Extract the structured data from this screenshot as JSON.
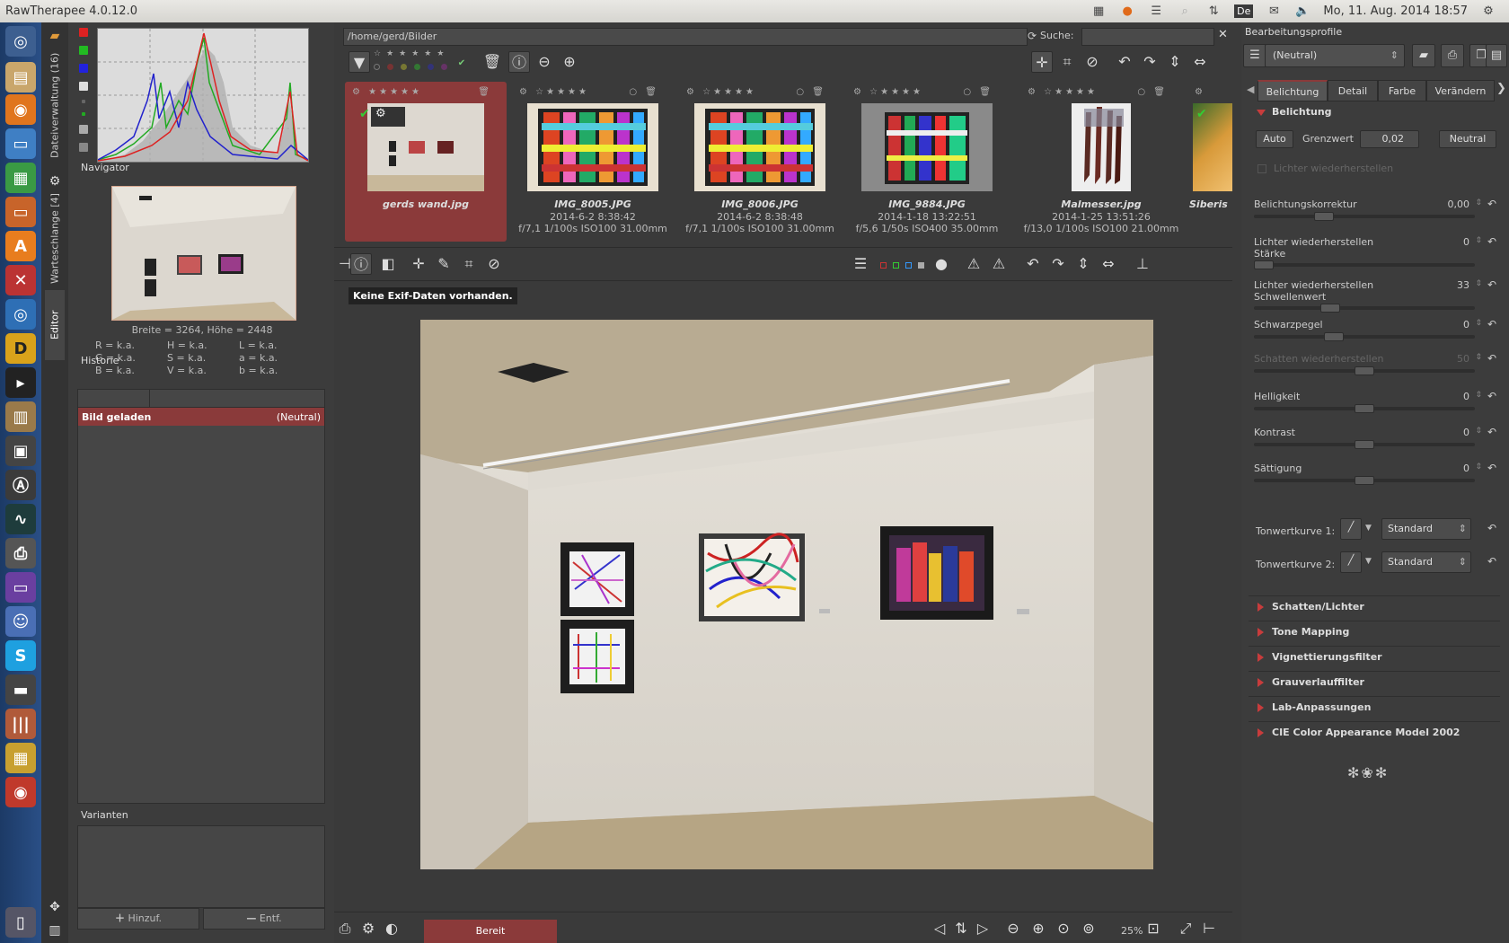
{
  "window": {
    "title": "RawTherapee 4.0.12.0"
  },
  "system_tray": {
    "language": "De",
    "datetime": "Mo, 11. Aug. 2014 18:57"
  },
  "vertical_tabs": {
    "file_browser": "Dateiverwaltung (16)",
    "queue": "Warteschlange [4]",
    "editor": "Editor"
  },
  "left_panel": {
    "navigator_title": "Navigator",
    "image_size": "Breite = 3264, Höhe = 2448",
    "channels": [
      "R = k.a.",
      "H = k.a.",
      "L = k.a.",
      "G = k.a.",
      "S = k.a.",
      "a = k.a.",
      "B = k.a.",
      "V = k.a.",
      "b = k.a."
    ],
    "history_title": "Historie",
    "history": [
      {
        "action": "Bild geladen",
        "value": "(Neutral)"
      }
    ],
    "variants_title": "Varianten",
    "add_label": "Hinzuf.",
    "remove_label": "Entf."
  },
  "file_browser": {
    "path": "/home/gerd/Bilder",
    "search_label": "Suche:",
    "search_value": "",
    "thumbnails": [
      {
        "name": "gerds wand.jpg",
        "date": "",
        "exif": ""
      },
      {
        "name": "IMG_8005.JPG",
        "date": "2014-6-2 8:38:42",
        "exif": "f/7,1 1/100s ISO100 31.00mm"
      },
      {
        "name": "IMG_8006.JPG",
        "date": "2014-6-2 8:38:48",
        "exif": "f/7,1 1/100s ISO100 31.00mm"
      },
      {
        "name": "IMG_9884.JPG",
        "date": "2014-1-18 13:22:51",
        "exif": "f/5,6 1/50s ISO400 35.00mm"
      },
      {
        "name": "Malmesser.jpg",
        "date": "2014-1-25 13:51:26",
        "exif": "f/13,0 1/100s ISO100 21.00mm"
      },
      {
        "name": "Siberis",
        "date": "",
        "exif": ""
      }
    ]
  },
  "editor": {
    "exif_message": "Keine Exif-Daten vorhanden.",
    "status": "Bereit",
    "zoom": "25%"
  },
  "right_panel": {
    "title": "Bearbeitungsprofile",
    "profile": "(Neutral)",
    "tabs": [
      "Belichtung",
      "Detail",
      "Farbe",
      "Verändern"
    ],
    "exposure": {
      "title": "Belichtung",
      "auto_label": "Auto",
      "clip_label": "Grenzwert",
      "clip_value": "0,02",
      "neutral_label": "Neutral",
      "highlight_recovery_checkbox": "Lichter wiederherstellen",
      "rows": [
        {
          "label": "Belichtungskorrektur",
          "value": "0,00",
          "level": 0.3,
          "dim": false
        },
        {
          "label": "Lichter wiederherstellen\nStärke",
          "value": "0",
          "level": 0.0,
          "dim": false
        },
        {
          "label": "Lichter wiederherstellen\nSchwellenwert",
          "value": "33",
          "level": 0.33,
          "dim": false
        },
        {
          "label": "Schwarzpegel",
          "value": "0",
          "level": 0.35,
          "dim": false
        },
        {
          "label": "Schatten wiederherstellen",
          "value": "50",
          "level": 0.5,
          "dim": true
        },
        {
          "label": "Helligkeit",
          "value": "0",
          "level": 0.5,
          "dim": false
        },
        {
          "label": "Kontrast",
          "value": "0",
          "level": 0.5,
          "dim": false
        },
        {
          "label": "Sättigung",
          "value": "0",
          "level": 0.5,
          "dim": false
        }
      ],
      "curve1_label": "Tonwertkurve 1:",
      "curve1_value": "Standard",
      "curve2_label": "Tonwertkurve 2:",
      "curve2_value": "Standard"
    },
    "sections": [
      "Schatten/Lichter",
      "Tone Mapping",
      "Vignettierungsfilter",
      "Grauverlauffilter",
      "Lab-Anpassungen",
      "CIE Color Appearance Model 2002"
    ]
  },
  "colors": {
    "accent": "#8b3a3a",
    "triangle": "#c83c3c",
    "panel": "#3c3c3c",
    "launcher": "#2a4f86"
  }
}
